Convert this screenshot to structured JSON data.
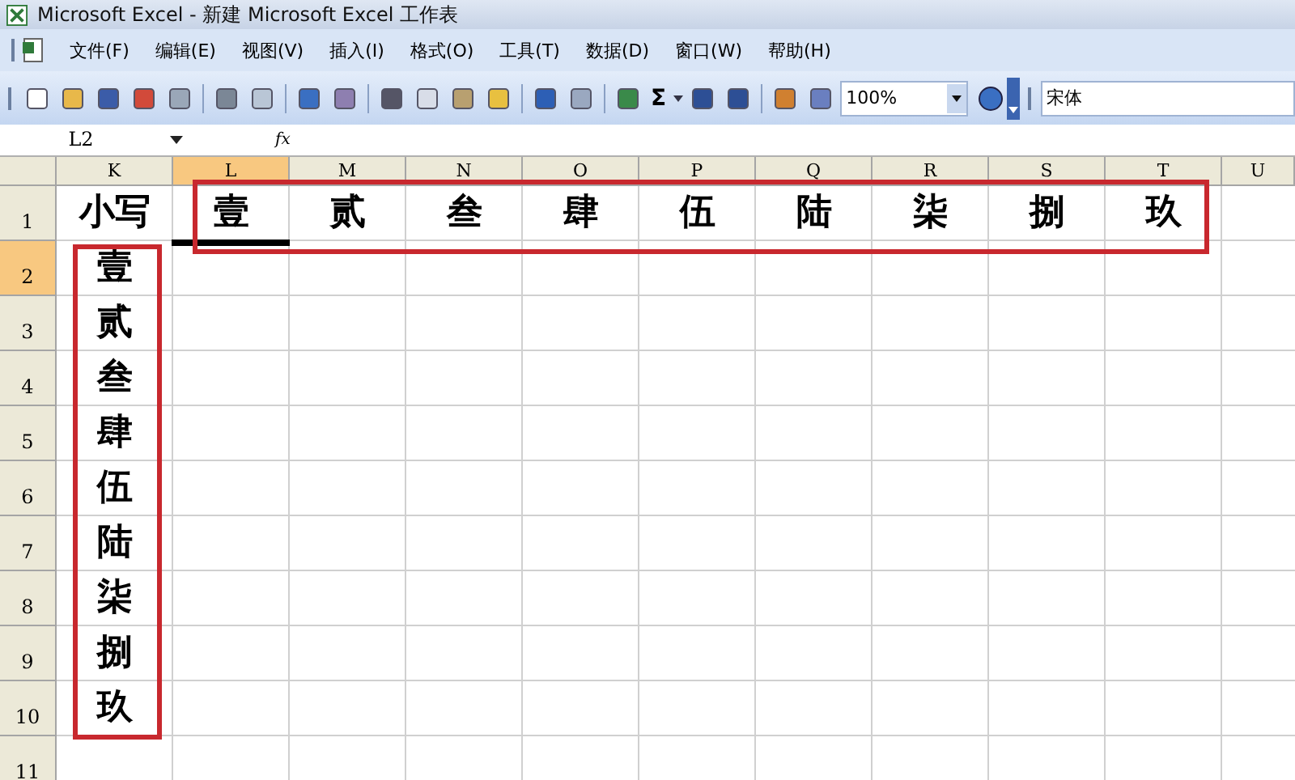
{
  "window": {
    "title": "Microsoft Excel - 新建 Microsoft Excel 工作表"
  },
  "menu": [
    {
      "label": "文件(F)"
    },
    {
      "label": "编辑(E)"
    },
    {
      "label": "视图(V)"
    },
    {
      "label": "插入(I)"
    },
    {
      "label": "格式(O)"
    },
    {
      "label": "工具(T)"
    },
    {
      "label": "数据(D)"
    },
    {
      "label": "窗口(W)"
    },
    {
      "label": "帮助(H)"
    }
  ],
  "toolbar": {
    "sum_symbol": "Σ",
    "zoom": "100%",
    "font": "宋体"
  },
  "formula_bar": {
    "name_box": "L2",
    "fx": "fx"
  },
  "columns": [
    {
      "label": "K",
      "selected": false
    },
    {
      "label": "L",
      "selected": true
    },
    {
      "label": "M",
      "selected": false
    },
    {
      "label": "N",
      "selected": false
    },
    {
      "label": "O",
      "selected": false
    },
    {
      "label": "P",
      "selected": false
    },
    {
      "label": "Q",
      "selected": false
    },
    {
      "label": "R",
      "selected": false
    },
    {
      "label": "S",
      "selected": false
    },
    {
      "label": "T",
      "selected": false
    },
    {
      "label": "U",
      "selected": false
    }
  ],
  "rows": [
    {
      "header": "1",
      "selected": false,
      "cells": [
        "小写",
        "壹",
        "贰",
        "叁",
        "肆",
        "伍",
        "陆",
        "柒",
        "捌",
        "玖"
      ]
    },
    {
      "header": "2",
      "selected": true,
      "cells": [
        "壹"
      ]
    },
    {
      "header": "3",
      "selected": false,
      "cells": [
        "贰"
      ]
    },
    {
      "header": "4",
      "selected": false,
      "cells": [
        "叁"
      ]
    },
    {
      "header": "5",
      "selected": false,
      "cells": [
        "肆"
      ]
    },
    {
      "header": "6",
      "selected": false,
      "cells": [
        "伍"
      ]
    },
    {
      "header": "7",
      "selected": false,
      "cells": [
        "陆"
      ]
    },
    {
      "header": "8",
      "selected": false,
      "cells": [
        "柒"
      ]
    },
    {
      "header": "9",
      "selected": false,
      "cells": [
        "捌"
      ]
    },
    {
      "header": "10",
      "selected": false,
      "cells": [
        "玖"
      ]
    },
    {
      "header": "11",
      "selected": false,
      "cells": []
    }
  ]
}
